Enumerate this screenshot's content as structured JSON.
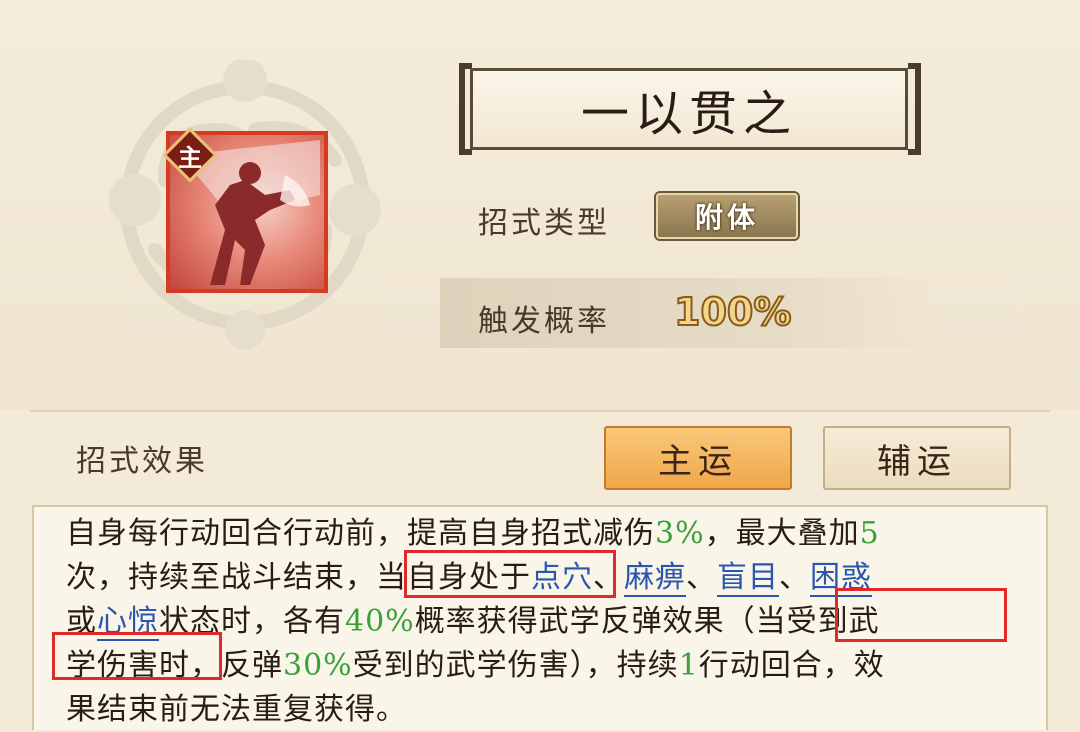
{
  "skill": {
    "title": "一以贯之",
    "badge": "主",
    "type_label": "招式类型",
    "type_value": "附体",
    "prob_label": "触发概率",
    "prob_value": "100%"
  },
  "effect": {
    "label": "招式效果",
    "tabs": [
      "主运",
      "辅运"
    ],
    "selected_tab": "主运"
  },
  "description": {
    "l1_a": "自身每行动回合行动前，提高自身招式减伤",
    "l1_v1": "3%",
    "l1_b": "，最大叠加",
    "l1_v2": "5",
    "l2_a": "次，持续至战斗结束，当自身处于",
    "l2_k1": "点穴",
    "l2_s1": "、",
    "l2_k2": "麻痹",
    "l2_s2": "、",
    "l2_k3": "盲目",
    "l2_s3": "、",
    "l2_k4": "困惑",
    "l3_a": "或",
    "l3_k5": "心惊",
    "l3_b": "状态时，各有",
    "l3_v": "40%",
    "l3_c": "概率获得武学反弹效果（当受到武",
    "l4_a": "学伤害时，反弹",
    "l4_v1": "30%",
    "l4_b": "受到的武学伤害），持续",
    "l4_v2": "1",
    "l4_c": "行动回合，效",
    "l5_a": "果结束前无法重复获得。"
  },
  "colors": {
    "highlight_box": "#e02a2a",
    "value_green": "#3aa13a",
    "keyword_blue": "#2a56b0",
    "tab_selected": "#f0a64a"
  }
}
